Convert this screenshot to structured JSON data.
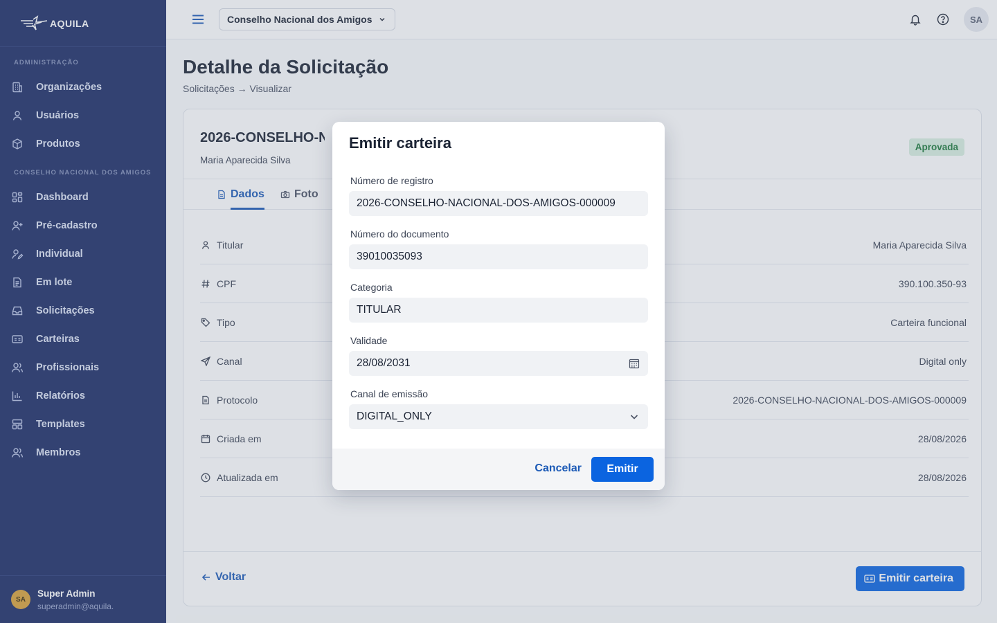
{
  "brand": {
    "name": "AQUILA"
  },
  "sidebar": {
    "sections": [
      {
        "title": "ADMINISTRAÇÃO",
        "items": [
          {
            "label": "Organizações",
            "icon": "building-icon"
          },
          {
            "label": "Usuários",
            "icon": "user-icon"
          },
          {
            "label": "Produtos",
            "icon": "package-icon"
          }
        ]
      },
      {
        "title": "CONSELHO NACIONAL DOS AMIGOS",
        "items": [
          {
            "label": "Dashboard",
            "icon": "dashboard-icon"
          },
          {
            "label": "Pré-cadastro",
            "icon": "user-plus-icon"
          },
          {
            "label": "Individual",
            "icon": "user-edit-icon"
          },
          {
            "label": "Em lote",
            "icon": "document-list-icon"
          },
          {
            "label": "Solicitações",
            "icon": "inbox-icon"
          },
          {
            "label": "Carteiras",
            "icon": "id-card-icon"
          },
          {
            "label": "Profissionais",
            "icon": "users-icon"
          },
          {
            "label": "Relatórios",
            "icon": "bar-chart-icon"
          },
          {
            "label": "Templates",
            "icon": "template-icon"
          },
          {
            "label": "Membros",
            "icon": "members-icon"
          }
        ]
      }
    ],
    "user": {
      "initials": "SA",
      "name": "Super Admin",
      "email": "superadmin@aquila."
    }
  },
  "topbar": {
    "org_selected": "Conselho Nacional dos Amigos",
    "avatar_initials": "SA"
  },
  "page": {
    "title": "Detalhe da Solicitação",
    "breadcrumb": "Solicitações → Visualizar"
  },
  "card": {
    "title": "2026-CONSELHO-N",
    "subtitle": "Maria Aparecida Silva",
    "status": "Aprovada",
    "tabs": [
      {
        "label": "Dados",
        "icon": "document-icon",
        "active": true
      },
      {
        "label": "Foto",
        "icon": "camera-icon",
        "active": false
      }
    ],
    "rows": [
      {
        "label": "Titular",
        "value": "Maria Aparecida Silva",
        "icon": "user-icon"
      },
      {
        "label": "CPF",
        "value": "390.100.350-93",
        "icon": "hash-icon"
      },
      {
        "label": "Tipo",
        "value": "Carteira funcional",
        "icon": "tag-icon"
      },
      {
        "label": "Canal",
        "value": "Digital only",
        "icon": "send-icon"
      },
      {
        "label": "Protocolo",
        "value": "2026-CONSELHO-NACIONAL-DOS-AMIGOS-000009",
        "icon": "document-icon"
      },
      {
        "label": "Criada em",
        "value": "28/08/2026",
        "icon": "calendar-icon"
      },
      {
        "label": "Atualizada em",
        "value": "28/08/2026",
        "icon": "clock-icon"
      }
    ],
    "back_label": "Voltar",
    "emit_label": "Emitir carteira"
  },
  "modal": {
    "title": "Emitir carteira",
    "fields": [
      {
        "label": "Número de registro",
        "value": "2026-CONSELHO-NACIONAL-DOS-AMIGOS-000009"
      },
      {
        "label": "Número do documento",
        "value": "39010035093"
      },
      {
        "label": "Categoria",
        "value": "TITULAR"
      },
      {
        "label": "Validade",
        "value": "28/08/2031"
      },
      {
        "label": "Canal de emissão",
        "value": "DIGITAL_ONLY"
      }
    ],
    "cancel_label": "Cancelar",
    "confirm_label": "Emitir"
  },
  "colors": {
    "sidebar_bg": "#1c2d66",
    "accent": "#0b64e0",
    "link": "#1c5ab6",
    "status_bg": "#d9efe0",
    "status_text": "#1e7a3c"
  }
}
